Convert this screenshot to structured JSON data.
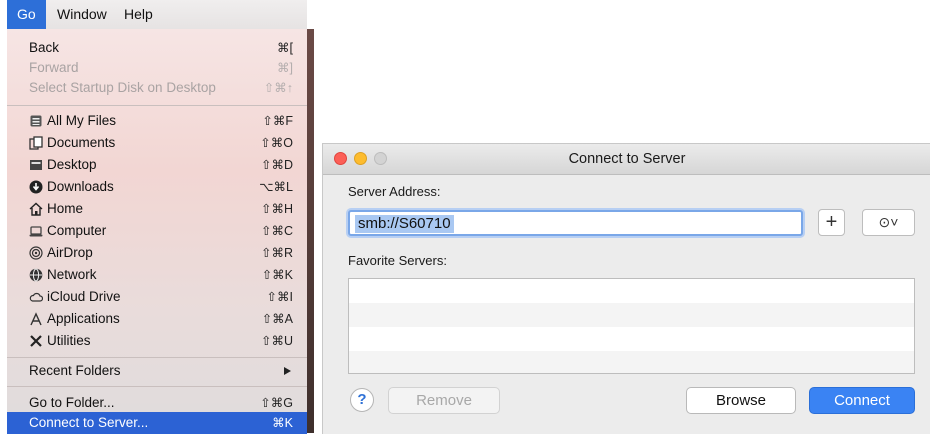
{
  "menubar": {
    "items": [
      "Go",
      "Window",
      "Help"
    ]
  },
  "go_menu": {
    "items": [
      {
        "label": "Back",
        "shortcut": "⌘[",
        "disabled": false
      },
      {
        "label": "Forward",
        "shortcut": "⌘]",
        "disabled": true
      },
      {
        "label": "Select Startup Disk on Desktop",
        "shortcut": "⇧⌘↑",
        "disabled": true
      },
      {
        "label": "All My Files",
        "shortcut": "⇧⌘F",
        "icon": "all-my-files"
      },
      {
        "label": "Documents",
        "shortcut": "⇧⌘O",
        "icon": "documents"
      },
      {
        "label": "Desktop",
        "shortcut": "⇧⌘D",
        "icon": "desktop"
      },
      {
        "label": "Downloads",
        "shortcut": "⌥⌘L",
        "icon": "downloads"
      },
      {
        "label": "Home",
        "shortcut": "⇧⌘H",
        "icon": "home"
      },
      {
        "label": "Computer",
        "shortcut": "⇧⌘C",
        "icon": "computer"
      },
      {
        "label": "AirDrop",
        "shortcut": "⇧⌘R",
        "icon": "airdrop"
      },
      {
        "label": "Network",
        "shortcut": "⇧⌘K",
        "icon": "network"
      },
      {
        "label": "iCloud Drive",
        "shortcut": "⇧⌘I",
        "icon": "icloud"
      },
      {
        "label": "Applications",
        "shortcut": "⇧⌘A",
        "icon": "applications"
      },
      {
        "label": "Utilities",
        "shortcut": "⇧⌘U",
        "icon": "utilities"
      },
      {
        "label": "Recent Folders",
        "shortcut": ""
      },
      {
        "label": "Go to Folder...",
        "shortcut": "⇧⌘G"
      },
      {
        "label": "Connect to Server...",
        "shortcut": "⌘K",
        "highlighted": true
      }
    ]
  },
  "dialog": {
    "title": "Connect to Server",
    "server_address_label": "Server Address:",
    "server_address_value": "smb://S60710",
    "add_button_glyph": "+",
    "recent_button_glyph": "⊙˅",
    "favorite_servers_label": "Favorite Servers:",
    "help_glyph": "?",
    "remove_label": "Remove",
    "browse_label": "Browse",
    "connect_label": "Connect"
  },
  "colors": {
    "accent": "#2c62d4",
    "close": "#fc5f57",
    "minimize": "#fdbc2e",
    "zoom": "#d3d3d3",
    "connect_button": "#3a83f3"
  }
}
